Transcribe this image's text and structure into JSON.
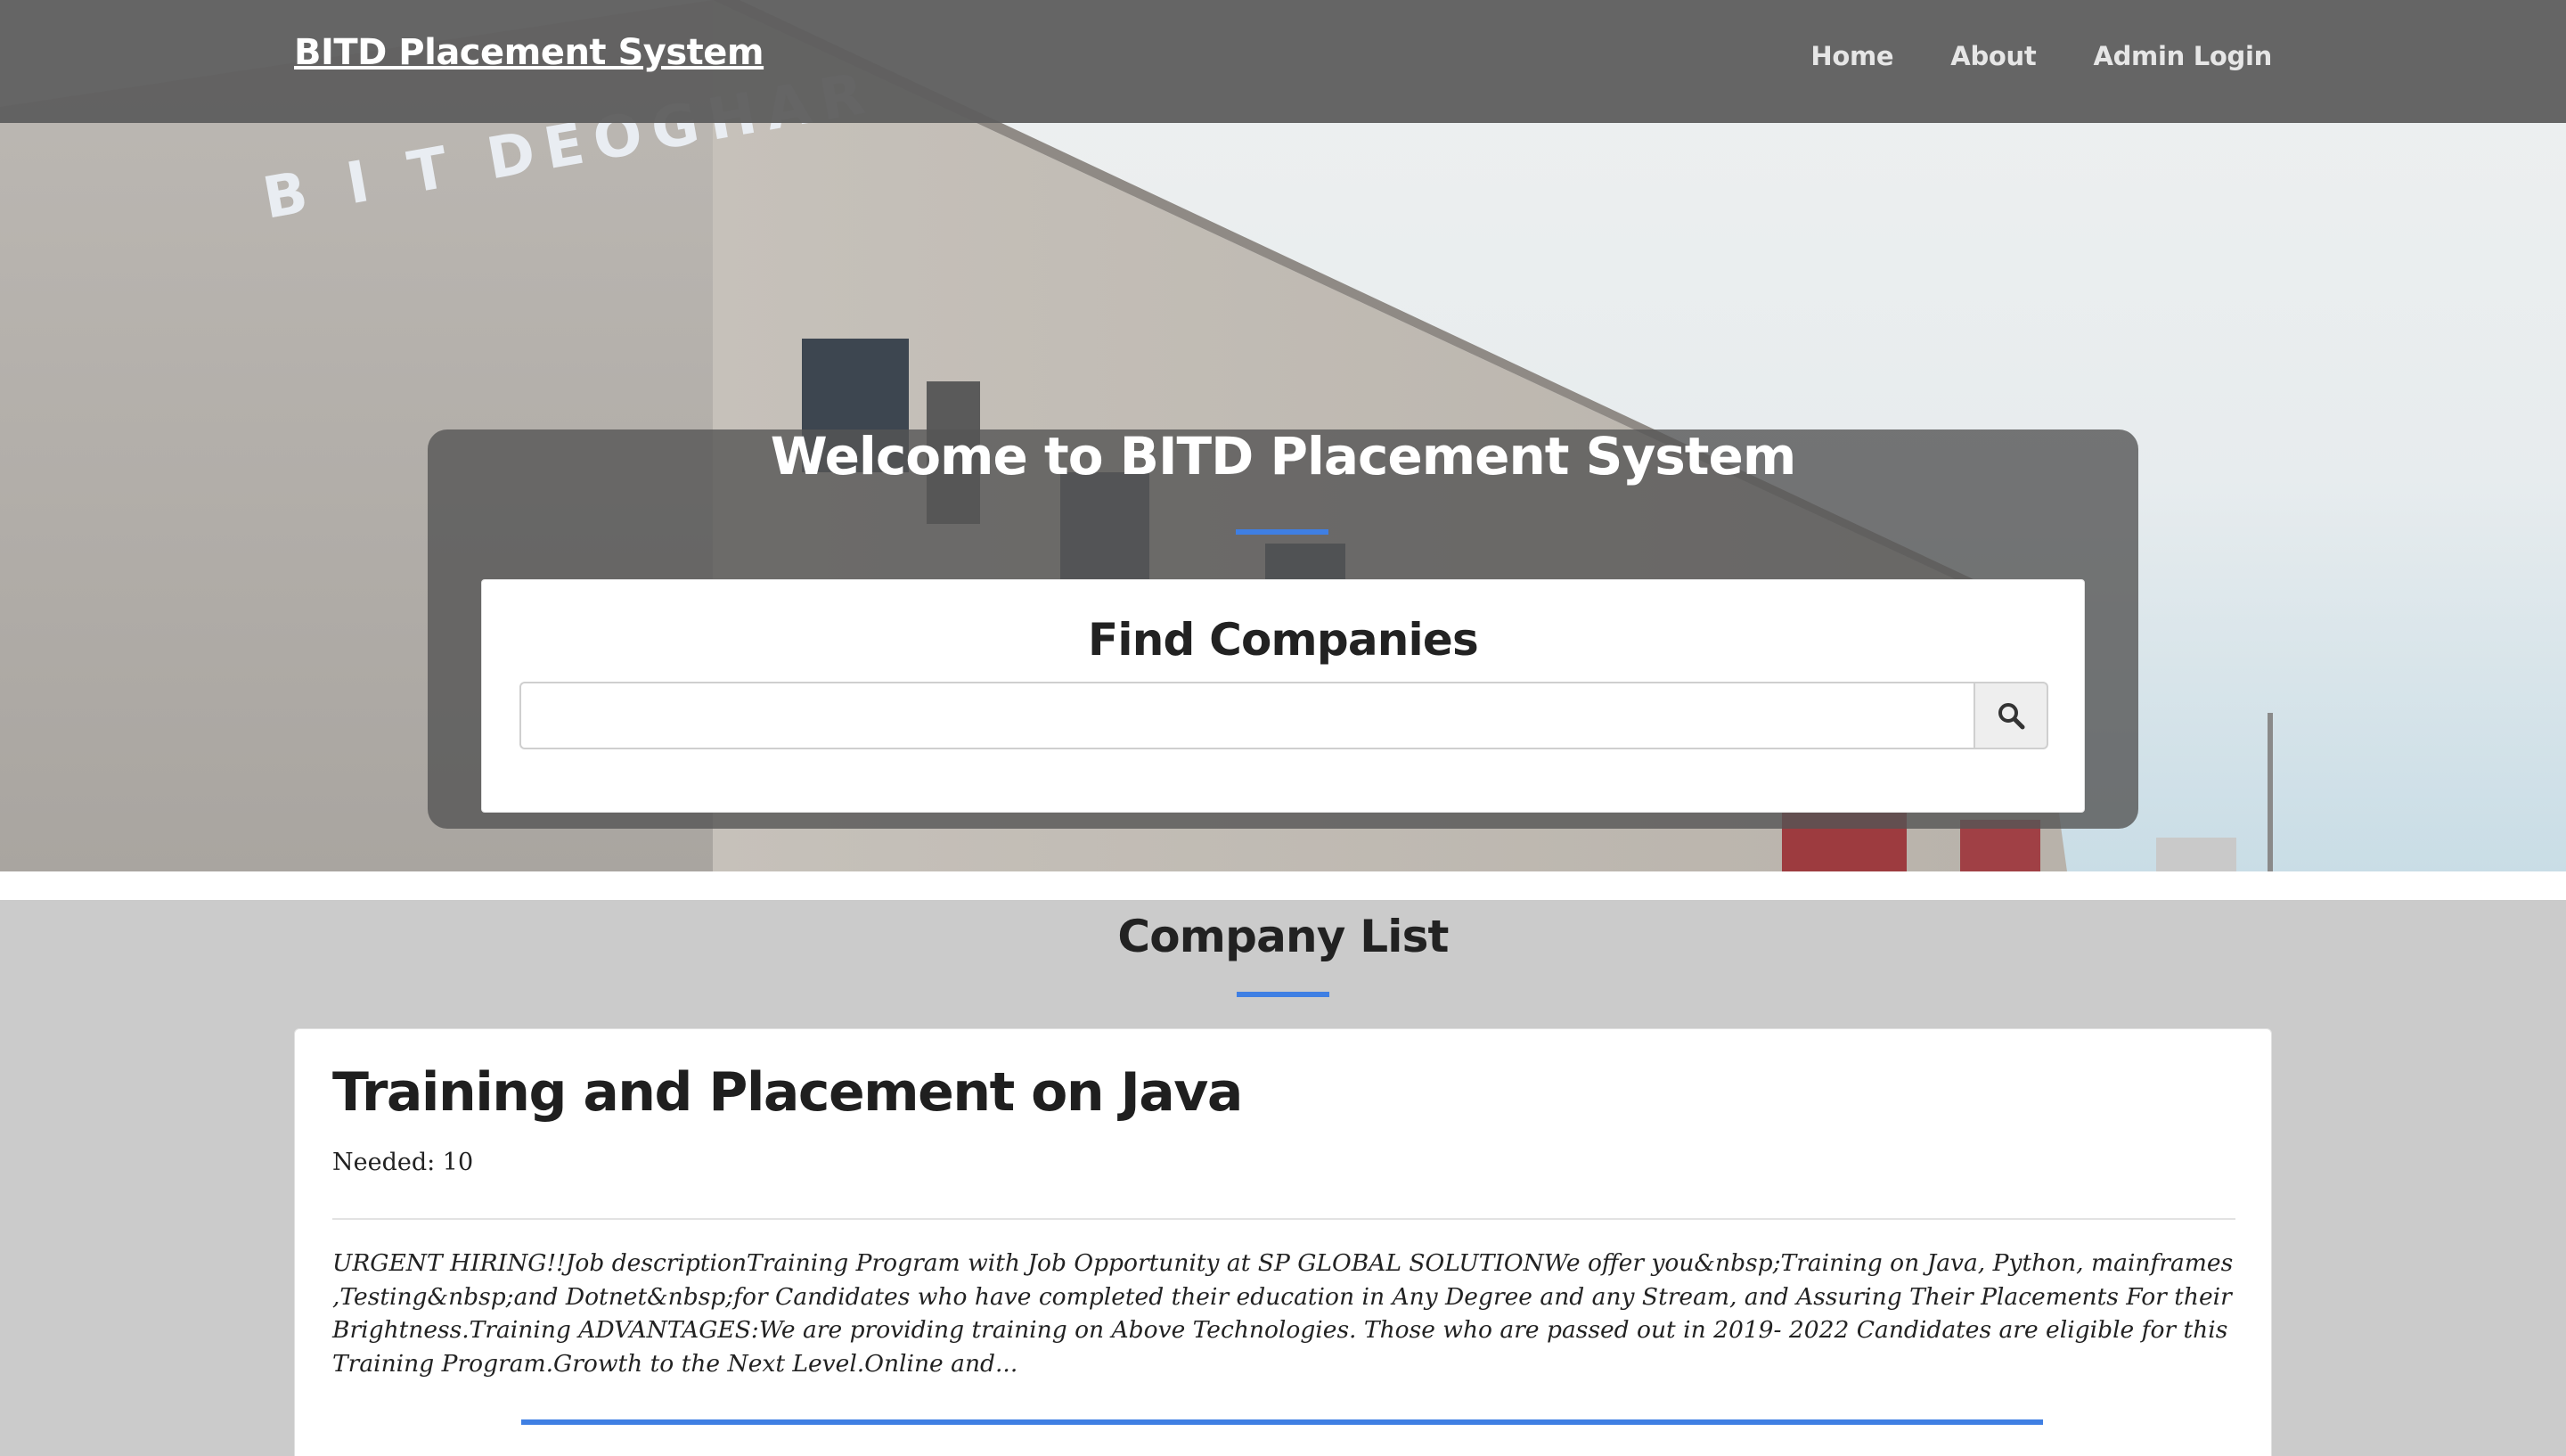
{
  "navbar": {
    "brand": "BITD Placement System",
    "links": [
      {
        "label": "Home"
      },
      {
        "label": "About"
      },
      {
        "label": "Admin Login"
      }
    ]
  },
  "hero": {
    "building_sign": "B I T  DEOGHAR",
    "welcome_title": "Welcome to BITD Placement System",
    "accent_color": "#3f7fe3"
  },
  "search": {
    "title": "Find Companies",
    "input_value": "",
    "button_icon": "search-icon"
  },
  "company_list": {
    "title": "Company List",
    "companies": [
      {
        "name": "Training and Placement on Java",
        "needed": "Needed: 10",
        "description": "URGENT HIRING!!Job descriptionTraining Program with Job Opportunity at SP GLOBAL SOLUTIONWe offer you&nbsp;Training on Java, Python, mainframes ,Testing&nbsp;and Dotnet&nbsp;for Candidates who have completed their education in Any Degree and any Stream, and Assuring Their Placements For their Brightness.Training ADVANTAGES:We are providing training on Above Technologies. Those who are passed out in 2019- 2022 Candidates are eligible for this Training Program.Growth to the Next Level.Online and..."
      }
    ]
  }
}
